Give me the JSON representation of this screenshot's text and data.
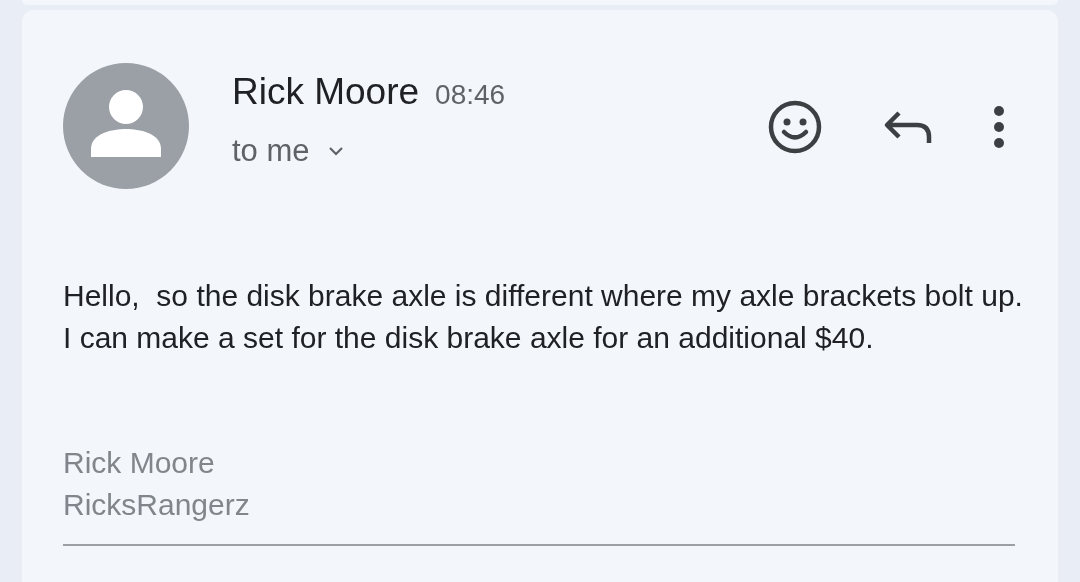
{
  "message": {
    "sender": "Rick Moore",
    "time": "08:46",
    "recipient": "to me",
    "body": "Hello,  so the disk brake axle is different where my axle brackets bolt up. I can make a set for the disk brake axle for an additional $40.",
    "signature": [
      "Rick Moore",
      "RicksRangerz"
    ]
  }
}
